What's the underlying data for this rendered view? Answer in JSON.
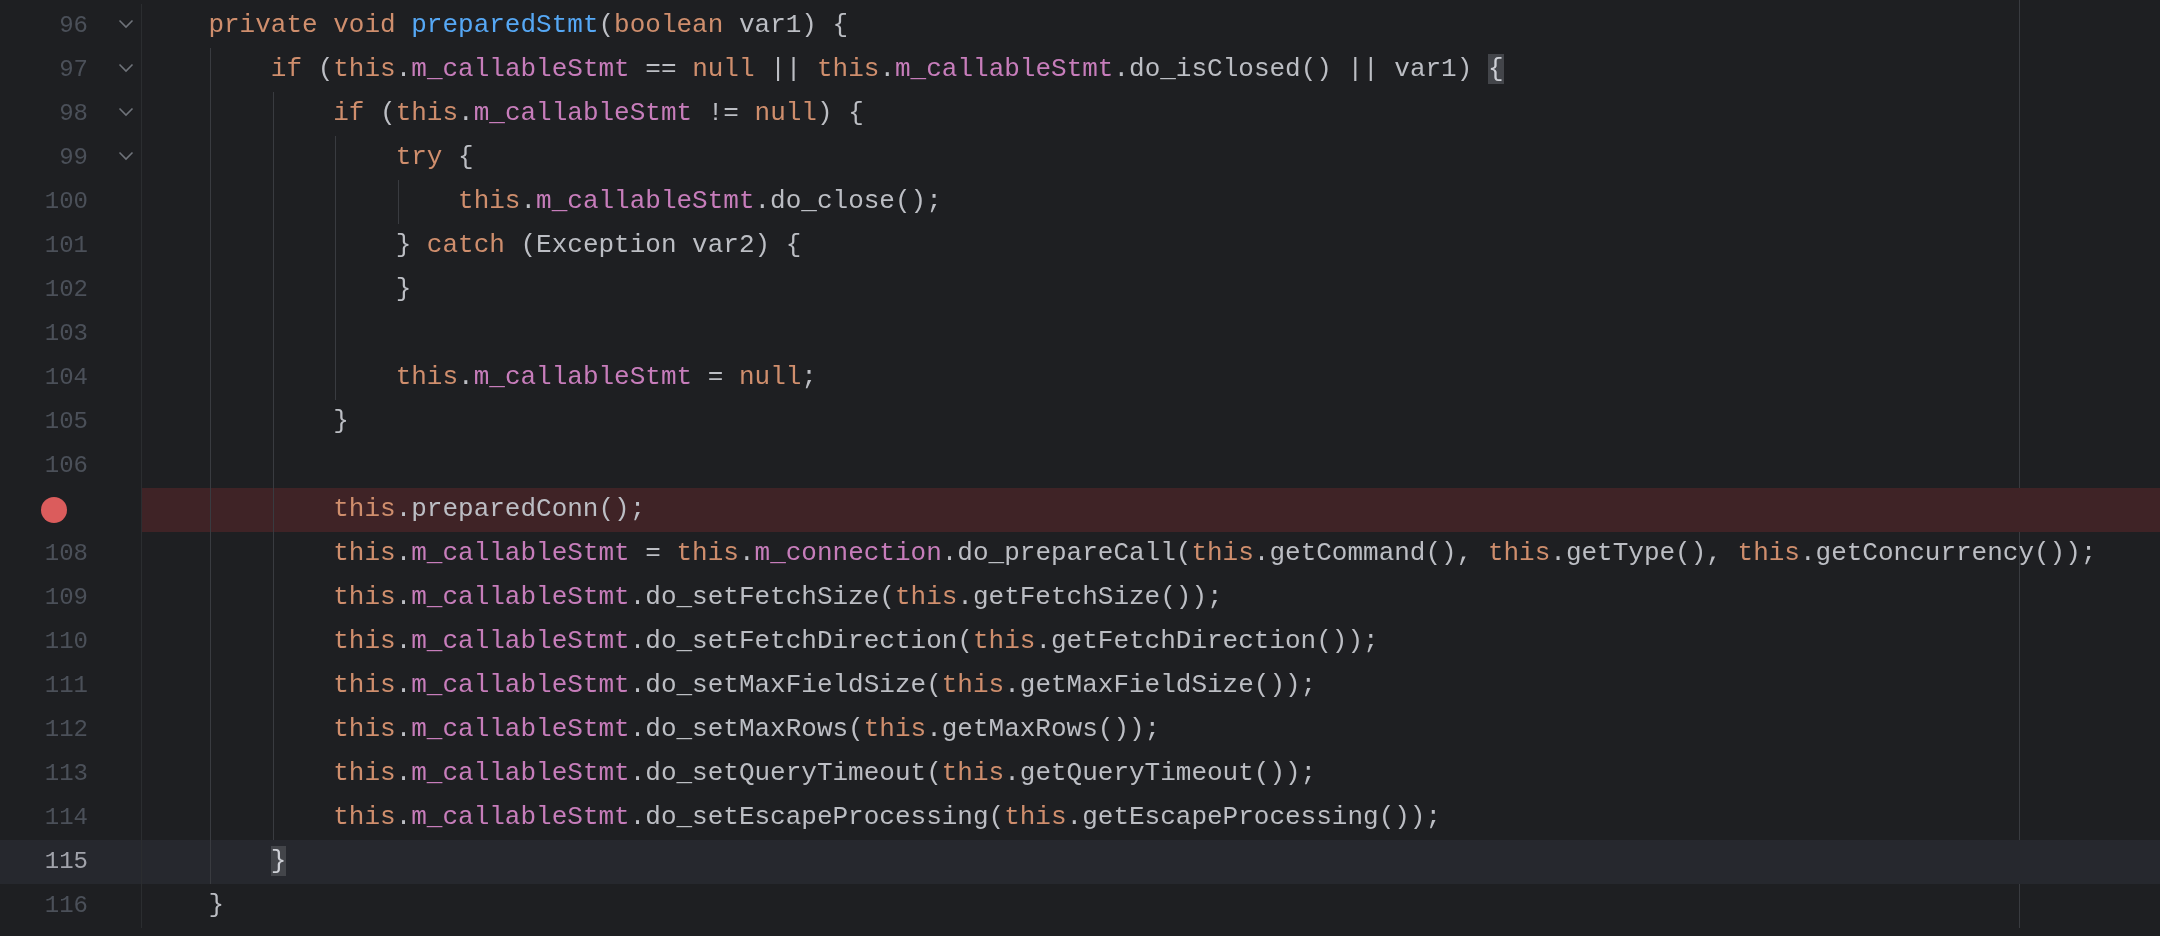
{
  "editor": {
    "lines": [
      {
        "number": "96",
        "fold": true,
        "breakpoint": false,
        "current": false,
        "tokens": [
          {
            "kind": "kw",
            "text": "    private void "
          },
          {
            "kind": "decl",
            "text": "preparedStmt"
          },
          {
            "kind": "plain",
            "text": "("
          },
          {
            "kind": "kw",
            "text": "boolean "
          },
          {
            "kind": "plain",
            "text": "var1) {"
          }
        ]
      },
      {
        "number": "97",
        "fold": true,
        "breakpoint": false,
        "current": false,
        "tokens": [
          {
            "kind": "kw",
            "text": "        if "
          },
          {
            "kind": "plain",
            "text": "("
          },
          {
            "kind": "kw",
            "text": "this"
          },
          {
            "kind": "plain",
            "text": "."
          },
          {
            "kind": "field",
            "text": "m_callableStmt"
          },
          {
            "kind": "plain",
            "text": " == "
          },
          {
            "kind": "kw",
            "text": "null"
          },
          {
            "kind": "plain",
            "text": " || "
          },
          {
            "kind": "kw",
            "text": "this"
          },
          {
            "kind": "plain",
            "text": "."
          },
          {
            "kind": "field",
            "text": "m_callableStmt"
          },
          {
            "kind": "plain",
            "text": ".do_isClosed() || var1) "
          },
          {
            "kind": "match",
            "text": "{"
          }
        ]
      },
      {
        "number": "98",
        "fold": true,
        "breakpoint": false,
        "current": false,
        "tokens": [
          {
            "kind": "kw",
            "text": "            if "
          },
          {
            "kind": "plain",
            "text": "("
          },
          {
            "kind": "kw",
            "text": "this"
          },
          {
            "kind": "plain",
            "text": "."
          },
          {
            "kind": "field",
            "text": "m_callableStmt"
          },
          {
            "kind": "plain",
            "text": " != "
          },
          {
            "kind": "kw",
            "text": "null"
          },
          {
            "kind": "plain",
            "text": ") {"
          }
        ]
      },
      {
        "number": "99",
        "fold": true,
        "breakpoint": false,
        "current": false,
        "tokens": [
          {
            "kind": "kw",
            "text": "                try "
          },
          {
            "kind": "plain",
            "text": "{"
          }
        ]
      },
      {
        "number": "100",
        "fold": false,
        "breakpoint": false,
        "current": false,
        "tokens": [
          {
            "kind": "kw",
            "text": "                    this"
          },
          {
            "kind": "plain",
            "text": "."
          },
          {
            "kind": "field",
            "text": "m_callableStmt"
          },
          {
            "kind": "plain",
            "text": ".do_close();"
          }
        ]
      },
      {
        "number": "101",
        "fold": false,
        "breakpoint": false,
        "current": false,
        "tokens": [
          {
            "kind": "plain",
            "text": "                } "
          },
          {
            "kind": "kw",
            "text": "catch "
          },
          {
            "kind": "plain",
            "text": "(Exception var2) {"
          }
        ]
      },
      {
        "number": "102",
        "fold": false,
        "breakpoint": false,
        "current": false,
        "tokens": [
          {
            "kind": "plain",
            "text": "                }"
          }
        ]
      },
      {
        "number": "103",
        "fold": false,
        "breakpoint": false,
        "current": false
      },
      {
        "number": "104",
        "fold": false,
        "breakpoint": false,
        "current": false,
        "tokens": [
          {
            "kind": "kw",
            "text": "                this"
          },
          {
            "kind": "plain",
            "text": "."
          },
          {
            "kind": "field",
            "text": "m_callableStmt"
          },
          {
            "kind": "plain",
            "text": " = "
          },
          {
            "kind": "kw",
            "text": "null"
          },
          {
            "kind": "plain",
            "text": ";"
          }
        ]
      },
      {
        "number": "105",
        "fold": false,
        "breakpoint": false,
        "current": false,
        "tokens": [
          {
            "kind": "plain",
            "text": "            }"
          }
        ]
      },
      {
        "number": "106",
        "fold": false,
        "breakpoint": false,
        "current": false
      },
      {
        "fold": false,
        "breakpoint": true,
        "current": false,
        "tokens": [
          {
            "kind": "kw",
            "text": "            this"
          },
          {
            "kind": "plain",
            "text": ".preparedConn();"
          }
        ]
      },
      {
        "number": "108",
        "fold": false,
        "breakpoint": false,
        "current": false,
        "tokens": [
          {
            "kind": "kw",
            "text": "            this"
          },
          {
            "kind": "plain",
            "text": "."
          },
          {
            "kind": "field",
            "text": "m_callableStmt"
          },
          {
            "kind": "plain",
            "text": " = "
          },
          {
            "kind": "kw",
            "text": "this"
          },
          {
            "kind": "plain",
            "text": "."
          },
          {
            "kind": "field",
            "text": "m_connection"
          },
          {
            "kind": "plain",
            "text": ".do_prepareCall("
          },
          {
            "kind": "kw",
            "text": "this"
          },
          {
            "kind": "plain",
            "text": ".getCommand(), "
          },
          {
            "kind": "kw",
            "text": "this"
          },
          {
            "kind": "plain",
            "text": ".getType(), "
          },
          {
            "kind": "kw",
            "text": "this"
          },
          {
            "kind": "plain",
            "text": ".getConcurrency());"
          }
        ]
      },
      {
        "number": "109",
        "fold": false,
        "breakpoint": false,
        "current": false,
        "tokens": [
          {
            "kind": "kw",
            "text": "            this"
          },
          {
            "kind": "plain",
            "text": "."
          },
          {
            "kind": "field",
            "text": "m_callableStmt"
          },
          {
            "kind": "plain",
            "text": ".do_setFetchSize("
          },
          {
            "kind": "kw",
            "text": "this"
          },
          {
            "kind": "plain",
            "text": ".getFetchSize());"
          }
        ]
      },
      {
        "number": "110",
        "fold": false,
        "breakpoint": false,
        "current": false,
        "tokens": [
          {
            "kind": "kw",
            "text": "            this"
          },
          {
            "kind": "plain",
            "text": "."
          },
          {
            "kind": "field",
            "text": "m_callableStmt"
          },
          {
            "kind": "plain",
            "text": ".do_setFetchDirection("
          },
          {
            "kind": "kw",
            "text": "this"
          },
          {
            "kind": "plain",
            "text": ".getFetchDirection());"
          }
        ]
      },
      {
        "number": "111",
        "fold": false,
        "breakpoint": false,
        "current": false,
        "tokens": [
          {
            "kind": "kw",
            "text": "            this"
          },
          {
            "kind": "plain",
            "text": "."
          },
          {
            "kind": "field",
            "text": "m_callableStmt"
          },
          {
            "kind": "plain",
            "text": ".do_setMaxFieldSize("
          },
          {
            "kind": "kw",
            "text": "this"
          },
          {
            "kind": "plain",
            "text": ".getMaxFieldSize());"
          }
        ]
      },
      {
        "number": "112",
        "fold": false,
        "breakpoint": false,
        "current": false,
        "tokens": [
          {
            "kind": "kw",
            "text": "            this"
          },
          {
            "kind": "plain",
            "text": "."
          },
          {
            "kind": "field",
            "text": "m_callableStmt"
          },
          {
            "kind": "plain",
            "text": ".do_setMaxRows("
          },
          {
            "kind": "kw",
            "text": "this"
          },
          {
            "kind": "plain",
            "text": ".getMaxRows());"
          }
        ]
      },
      {
        "number": "113",
        "fold": false,
        "breakpoint": false,
        "current": false,
        "tokens": [
          {
            "kind": "kw",
            "text": "            this"
          },
          {
            "kind": "plain",
            "text": "."
          },
          {
            "kind": "field",
            "text": "m_callableStmt"
          },
          {
            "kind": "plain",
            "text": ".do_setQueryTimeout("
          },
          {
            "kind": "kw",
            "text": "this"
          },
          {
            "kind": "plain",
            "text": ".getQueryTimeout());"
          }
        ]
      },
      {
        "number": "114",
        "fold": false,
        "breakpoint": false,
        "current": false,
        "tokens": [
          {
            "kind": "kw",
            "text": "            this"
          },
          {
            "kind": "plain",
            "text": "."
          },
          {
            "kind": "field",
            "text": "m_callableStmt"
          },
          {
            "kind": "plain",
            "text": ".do_setEscapeProcessing("
          },
          {
            "kind": "kw",
            "text": "this"
          },
          {
            "kind": "plain",
            "text": ".getEscapeProcessing());"
          }
        ]
      },
      {
        "number": "115",
        "fold": false,
        "breakpoint": false,
        "current": true,
        "tokens": [
          {
            "kind": "match",
            "text": "        }"
          }
        ]
      },
      {
        "number": "116",
        "fold": false,
        "breakpoint": false,
        "current": false,
        "tokens": [
          {
            "kind": "plain",
            "text": "    }"
          }
        ]
      }
    ]
  }
}
